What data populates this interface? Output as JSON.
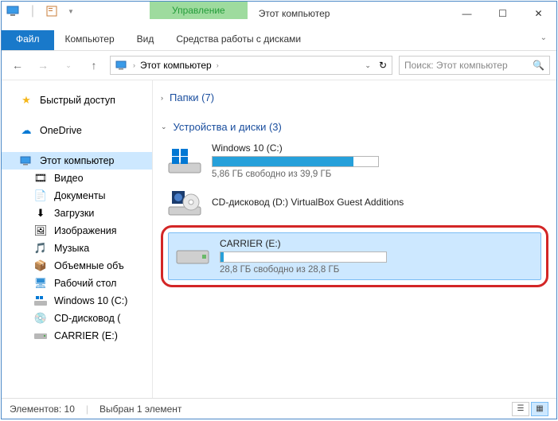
{
  "titlebar": {
    "context_label": "Управление",
    "window_title": "Этот компьютер"
  },
  "ribbon": {
    "file": "Файл",
    "tabs": [
      "Компьютер",
      "Вид",
      "Средства работы с дисками"
    ]
  },
  "address": {
    "crumb": "Этот компьютер",
    "search_placeholder": "Поиск: Этот компьютер"
  },
  "nav": {
    "quick_access": "Быстрый доступ",
    "onedrive": "OneDrive",
    "this_pc": "Этот компьютер",
    "items": [
      "Видео",
      "Документы",
      "Загрузки",
      "Изображения",
      "Музыка",
      "Объемные объ",
      "Рабочий стол",
      "Windows 10 (C:)",
      "CD-дисковод (",
      "CARRIER (E:)"
    ]
  },
  "content": {
    "folders_header": "Папки (7)",
    "devices_header": "Устройства и диски (3)",
    "drives": [
      {
        "name": "Windows 10 (C:)",
        "free": "5,86 ГБ свободно из 39,9 ГБ",
        "fill_pct": 85
      },
      {
        "name": "CD-дисковод (D:) VirtualBox Guest Additions",
        "free": "",
        "fill_pct": 0
      },
      {
        "name": "CARRIER (E:)",
        "free": "28,8 ГБ свободно из 28,8 ГБ",
        "fill_pct": 2
      }
    ]
  },
  "status": {
    "elements": "Элементов: 10",
    "selected": "Выбран 1 элемент"
  }
}
